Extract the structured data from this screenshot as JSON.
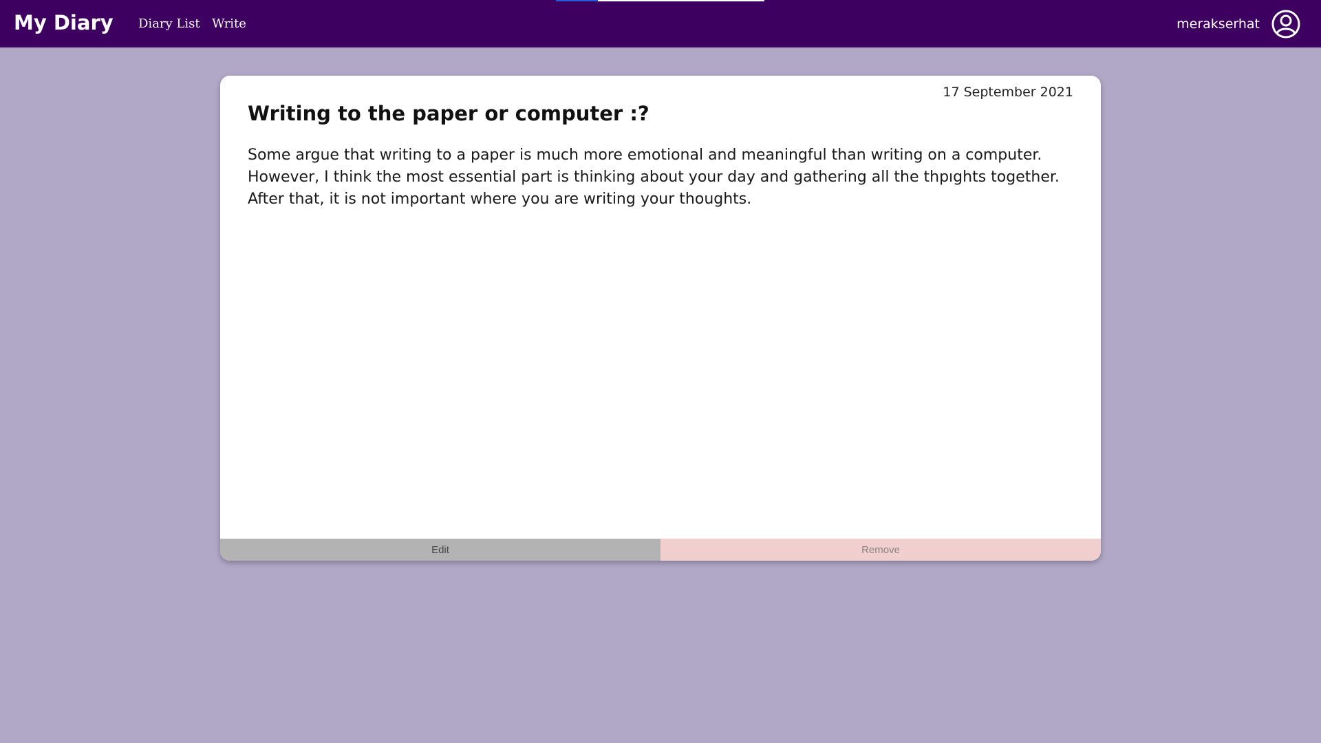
{
  "navbar": {
    "brand": "My Diary",
    "links": [
      {
        "label": "Diary List"
      },
      {
        "label": "Write"
      }
    ],
    "username": "merakserhat",
    "avatar_icon": "user-circle-icon",
    "background_color": "#3e0060",
    "loading_progress": 0.2
  },
  "entry": {
    "date": "17 September 2021",
    "title": "Writing to the paper or computer :?",
    "body": "Some argue that writing to a paper is much more emotional and meaningful than writing on a computer. However, I think the most essential part is thinking about your day and gathering all the thpıghts together. After that, it is not important where you are writing your thoughts.",
    "edit_label": "Edit",
    "remove_label": "Remove"
  },
  "colors": {
    "page_background": "#b1a7c7",
    "edit_button": "#b3b3b3",
    "remove_button": "#f1cfcf"
  }
}
